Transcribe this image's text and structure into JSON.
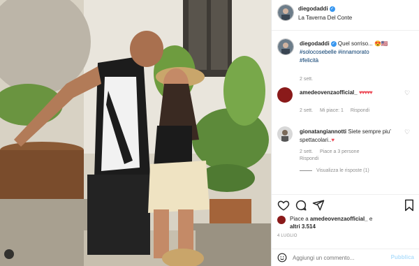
{
  "post": {
    "username": "diegodaddi",
    "location": "La Taverna Del Conte",
    "caption_text": "Quel sorriso...",
    "caption_emoji": "😍🇺🇸",
    "hashtags": [
      "#solocosebelle",
      "#innamorato",
      "#felicità"
    ],
    "time": "2 sett."
  },
  "comments": [
    {
      "username": "amedeovenzaofficial_",
      "text": "♥♥♥♥♥",
      "time": "2 sett.",
      "likes": "Mi piace: 1",
      "reply": "Rispondi"
    },
    {
      "username": "gionatangiannotti",
      "text": "Siete sempre piu' spettacolari..",
      "emoji": "♥",
      "time": "2 sett.",
      "likes": "Piace a 3 persone",
      "reply": "Rispondi",
      "view_replies": "Visualizza le risposte (1)"
    }
  ],
  "likes": {
    "prefix": "Piace a",
    "user": "amedeovenzaofficial_",
    "connector": "e",
    "others": "altri 3.514"
  },
  "date": "4 LUGLIO",
  "comment_box": {
    "placeholder": "Aggiungi un commento...",
    "publish": "Pubblica"
  },
  "icons": {
    "like": "heart-icon",
    "comment": "comment-icon",
    "share": "send-icon",
    "save": "bookmark-icon",
    "emoji": "smile-icon",
    "verified": "verified-badge-icon"
  },
  "colors": {
    "verified": "#3897f0",
    "heart": "#ed4956",
    "publish": "#b2dffc",
    "hashtag": "#00376b"
  }
}
